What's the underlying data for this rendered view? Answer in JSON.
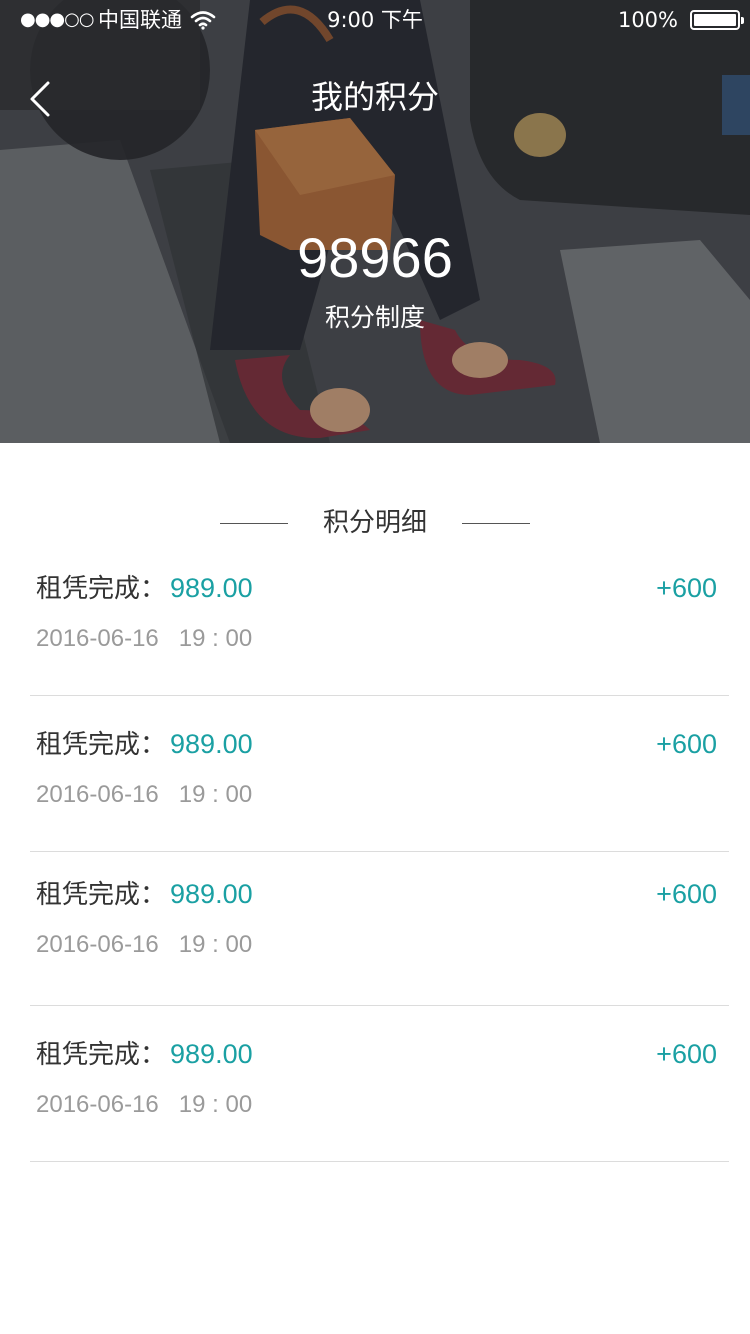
{
  "status_bar": {
    "signal": "●●●○○",
    "carrier": "中国联通",
    "time": "9:00 下午",
    "battery_percent": "100%",
    "battery_level": 1.0
  },
  "nav": {
    "title": "我的积分",
    "back_icon": "chevron-left-icon"
  },
  "points": {
    "value": "98966",
    "rule_link": "积分制度"
  },
  "details": {
    "title": "积分明细",
    "items": [
      {
        "label": "租凭完成：",
        "amount": "989.00",
        "delta": "+600",
        "date": "2016-06-16",
        "time": "19 : 00"
      },
      {
        "label": "租凭完成：",
        "amount": "989.00",
        "delta": "+600",
        "date": "2016-06-16",
        "time": "19 : 00"
      },
      {
        "label": "租凭完成：",
        "amount": "989.00",
        "delta": "+600",
        "date": "2016-06-16",
        "time": "19 : 00"
      },
      {
        "label": "租凭完成：",
        "amount": "989.00",
        "delta": "+600",
        "date": "2016-06-16",
        "time": "19 : 00"
      }
    ]
  },
  "colors": {
    "accent": "#1aa0a3",
    "secondary_text": "#9a9a9a",
    "primary_text": "#333333"
  }
}
